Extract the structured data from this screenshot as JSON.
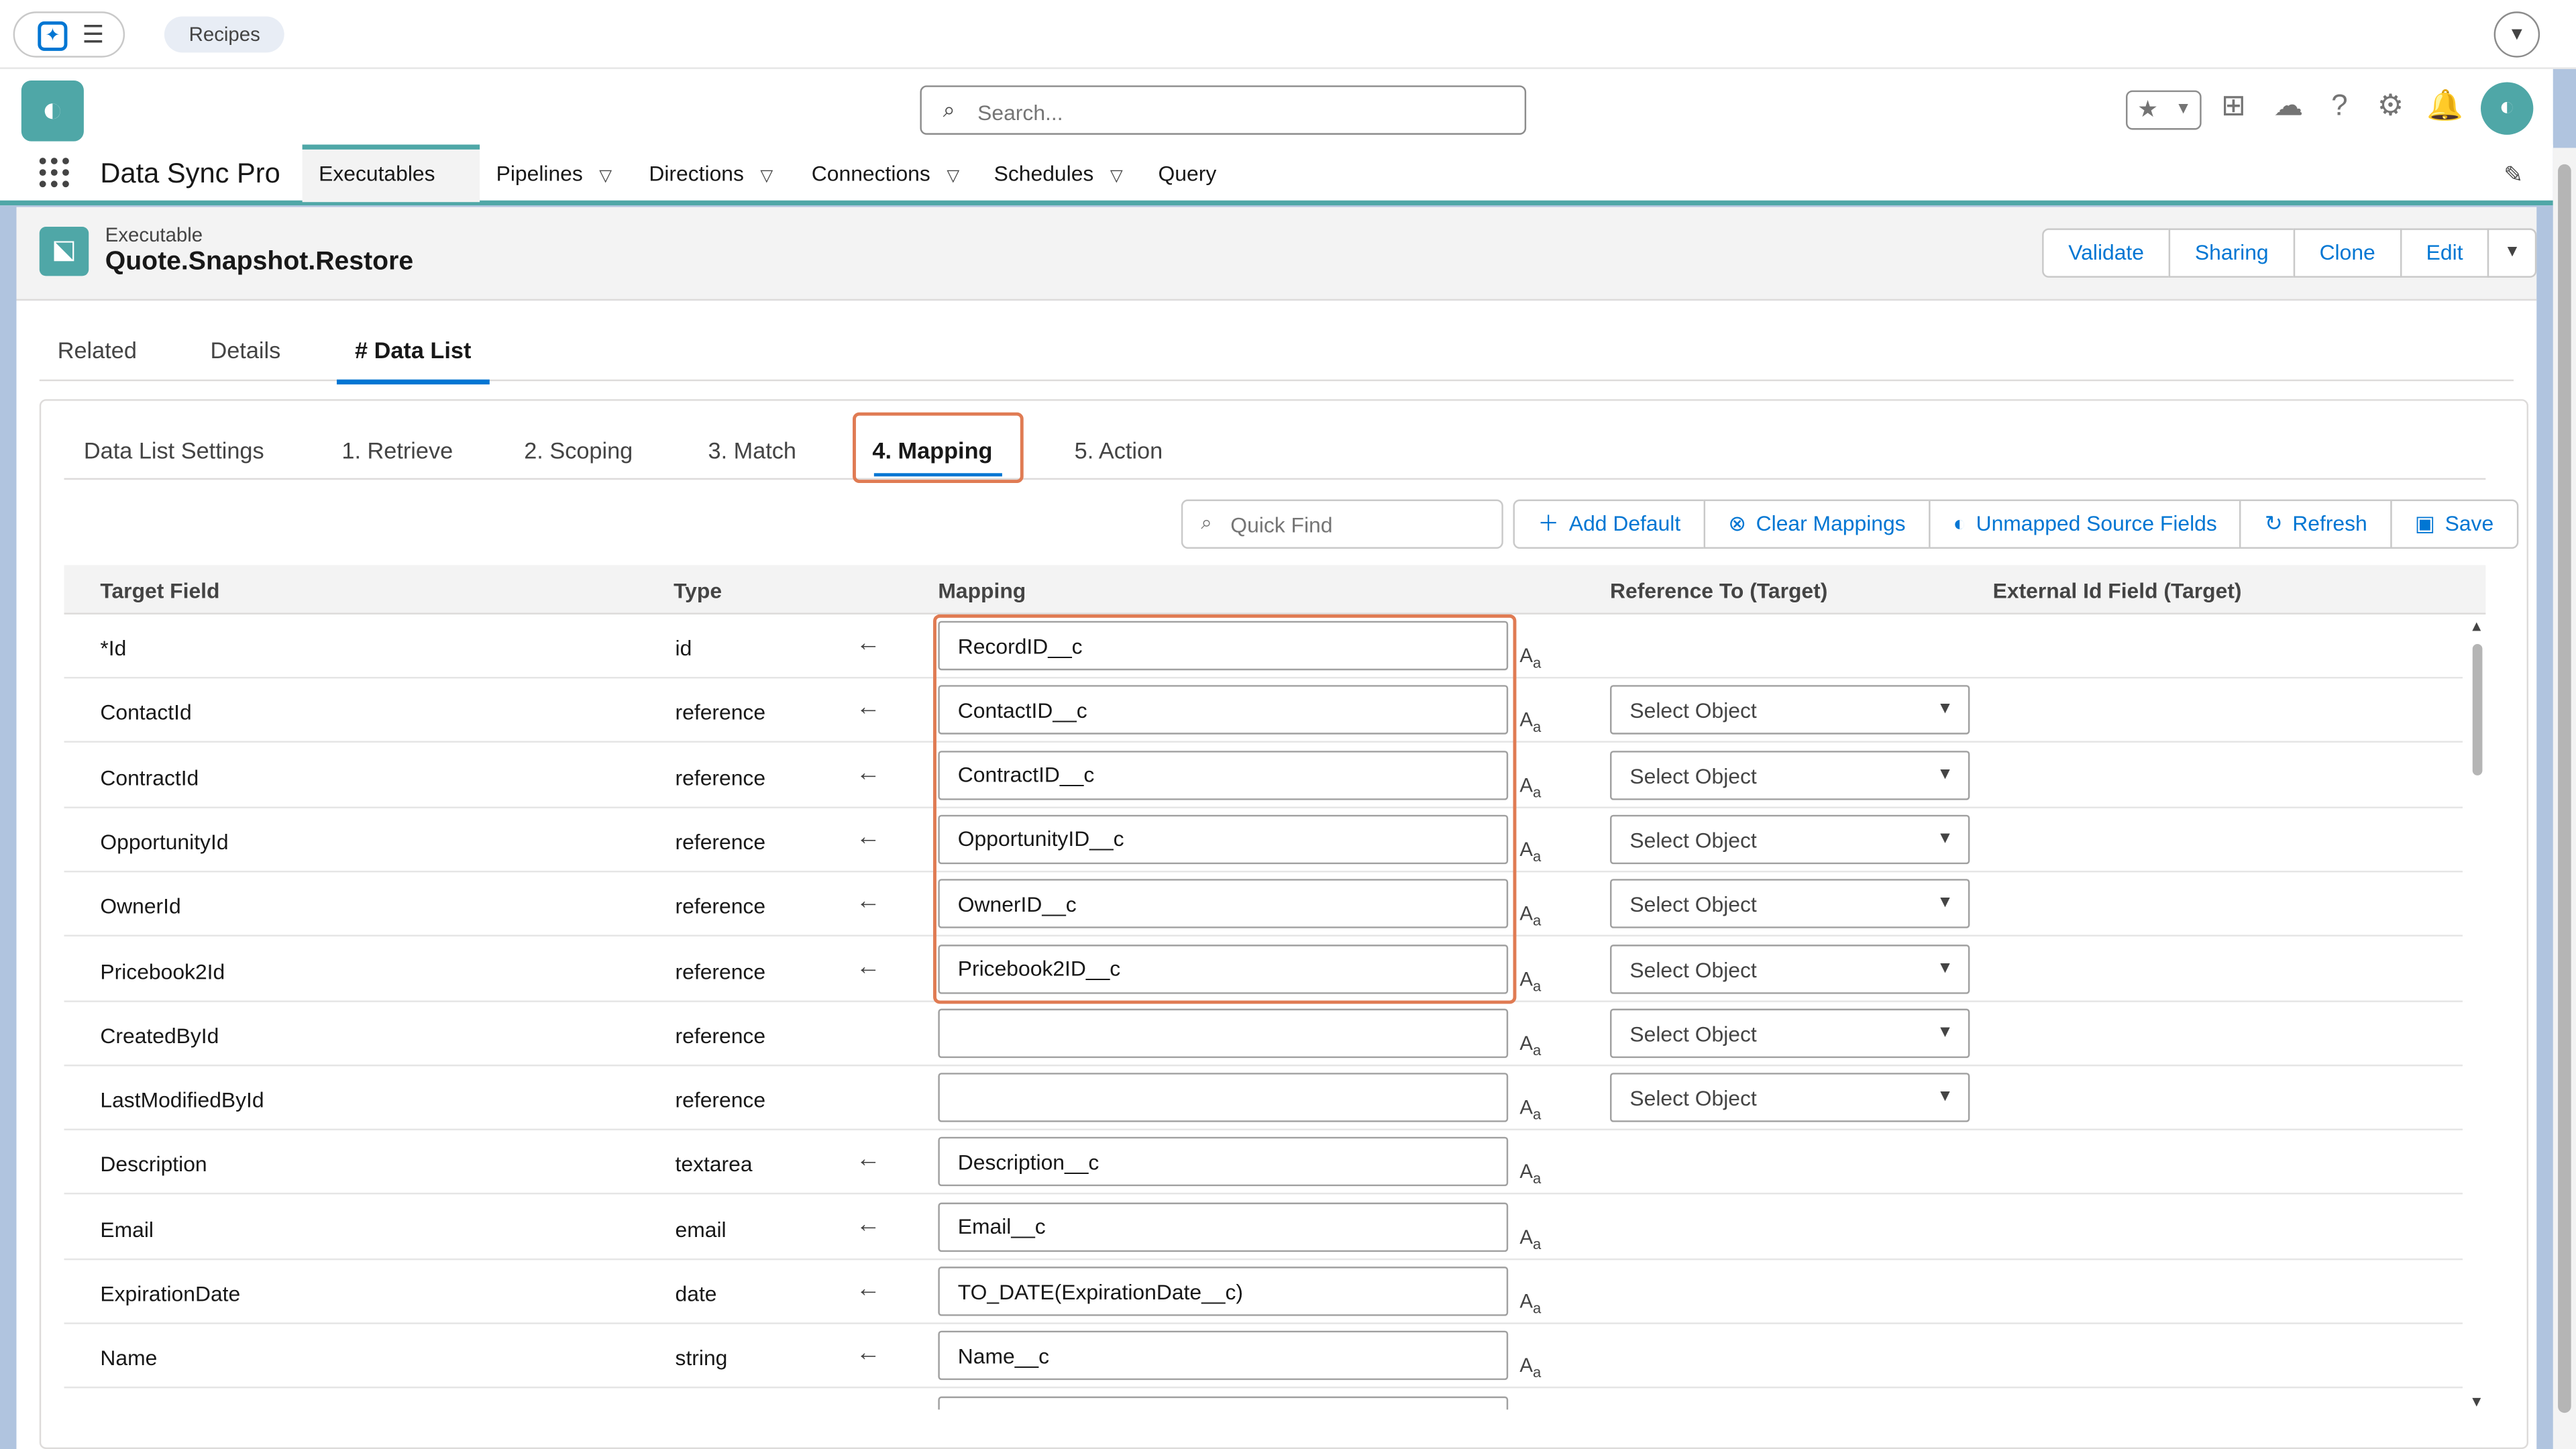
{
  "topbar": {
    "recipes": "Recipes"
  },
  "header": {
    "search_placeholder": "Search..."
  },
  "nav": {
    "app_name": "Data Sync Pro",
    "items": [
      {
        "label": "Executables",
        "active": true,
        "has_menu": true
      },
      {
        "label": "Pipelines",
        "has_menu": true
      },
      {
        "label": "Directions",
        "has_menu": true
      },
      {
        "label": "Connections",
        "has_menu": true
      },
      {
        "label": "Schedules",
        "has_menu": true
      },
      {
        "label": "Query",
        "has_menu": false
      }
    ]
  },
  "record": {
    "type": "Executable",
    "name": "Quote.Snapshot.Restore",
    "actions": [
      "Validate",
      "Sharing",
      "Clone",
      "Edit"
    ]
  },
  "tabs": [
    "Related",
    "Details",
    "# Data List"
  ],
  "active_tab": "# Data List",
  "subtabs": [
    "Data List Settings",
    "1. Retrieve",
    "2. Scoping",
    "3. Match",
    "4. Mapping",
    "5. Action"
  ],
  "active_subtab": "4. Mapping",
  "toolbar": {
    "quick_find_placeholder": "Quick Find",
    "buttons": [
      "Add Default",
      "Clear Mappings",
      "Unmapped Source Fields",
      "Refresh",
      "Save"
    ]
  },
  "table": {
    "headers": {
      "target_field": "Target Field",
      "type": "Type",
      "mapping": "Mapping",
      "reference_to": "Reference To (Target)",
      "external_id": "External Id Field (Target)"
    },
    "select_placeholder": "Select Object",
    "rows": [
      {
        "field": "*Id",
        "type": "id",
        "arrow": true,
        "mapping": "RecordID__c",
        "select": false
      },
      {
        "field": "ContactId",
        "type": "reference",
        "arrow": true,
        "mapping": "ContactID__c",
        "select": true
      },
      {
        "field": "ContractId",
        "type": "reference",
        "arrow": true,
        "mapping": "ContractID__c",
        "select": true
      },
      {
        "field": "OpportunityId",
        "type": "reference",
        "arrow": true,
        "mapping": "OpportunityID__c",
        "select": true
      },
      {
        "field": "OwnerId",
        "type": "reference",
        "arrow": true,
        "mapping": "OwnerID__c",
        "select": true
      },
      {
        "field": "Pricebook2Id",
        "type": "reference",
        "arrow": true,
        "mapping": "Pricebook2ID__c",
        "select": true
      },
      {
        "field": "CreatedById",
        "type": "reference",
        "arrow": false,
        "mapping": "",
        "select": true
      },
      {
        "field": "LastModifiedById",
        "type": "reference",
        "arrow": false,
        "mapping": "",
        "select": true
      },
      {
        "field": "Description",
        "type": "textarea",
        "arrow": true,
        "mapping": "Description__c",
        "select": false
      },
      {
        "field": "Email",
        "type": "email",
        "arrow": true,
        "mapping": "Email__c",
        "select": false
      },
      {
        "field": "ExpirationDate",
        "type": "date",
        "arrow": true,
        "mapping": "TO_DATE(ExpirationDate__c)",
        "select": false
      },
      {
        "field": "Name",
        "type": "string",
        "arrow": true,
        "mapping": "Name__c",
        "select": false
      },
      {
        "field": "",
        "type": "",
        "arrow": true,
        "mapping": "",
        "select": false
      }
    ]
  },
  "colors": {
    "accent": "#0176d3",
    "brand": "#4fa7a7",
    "highlight": "#e07b53"
  }
}
